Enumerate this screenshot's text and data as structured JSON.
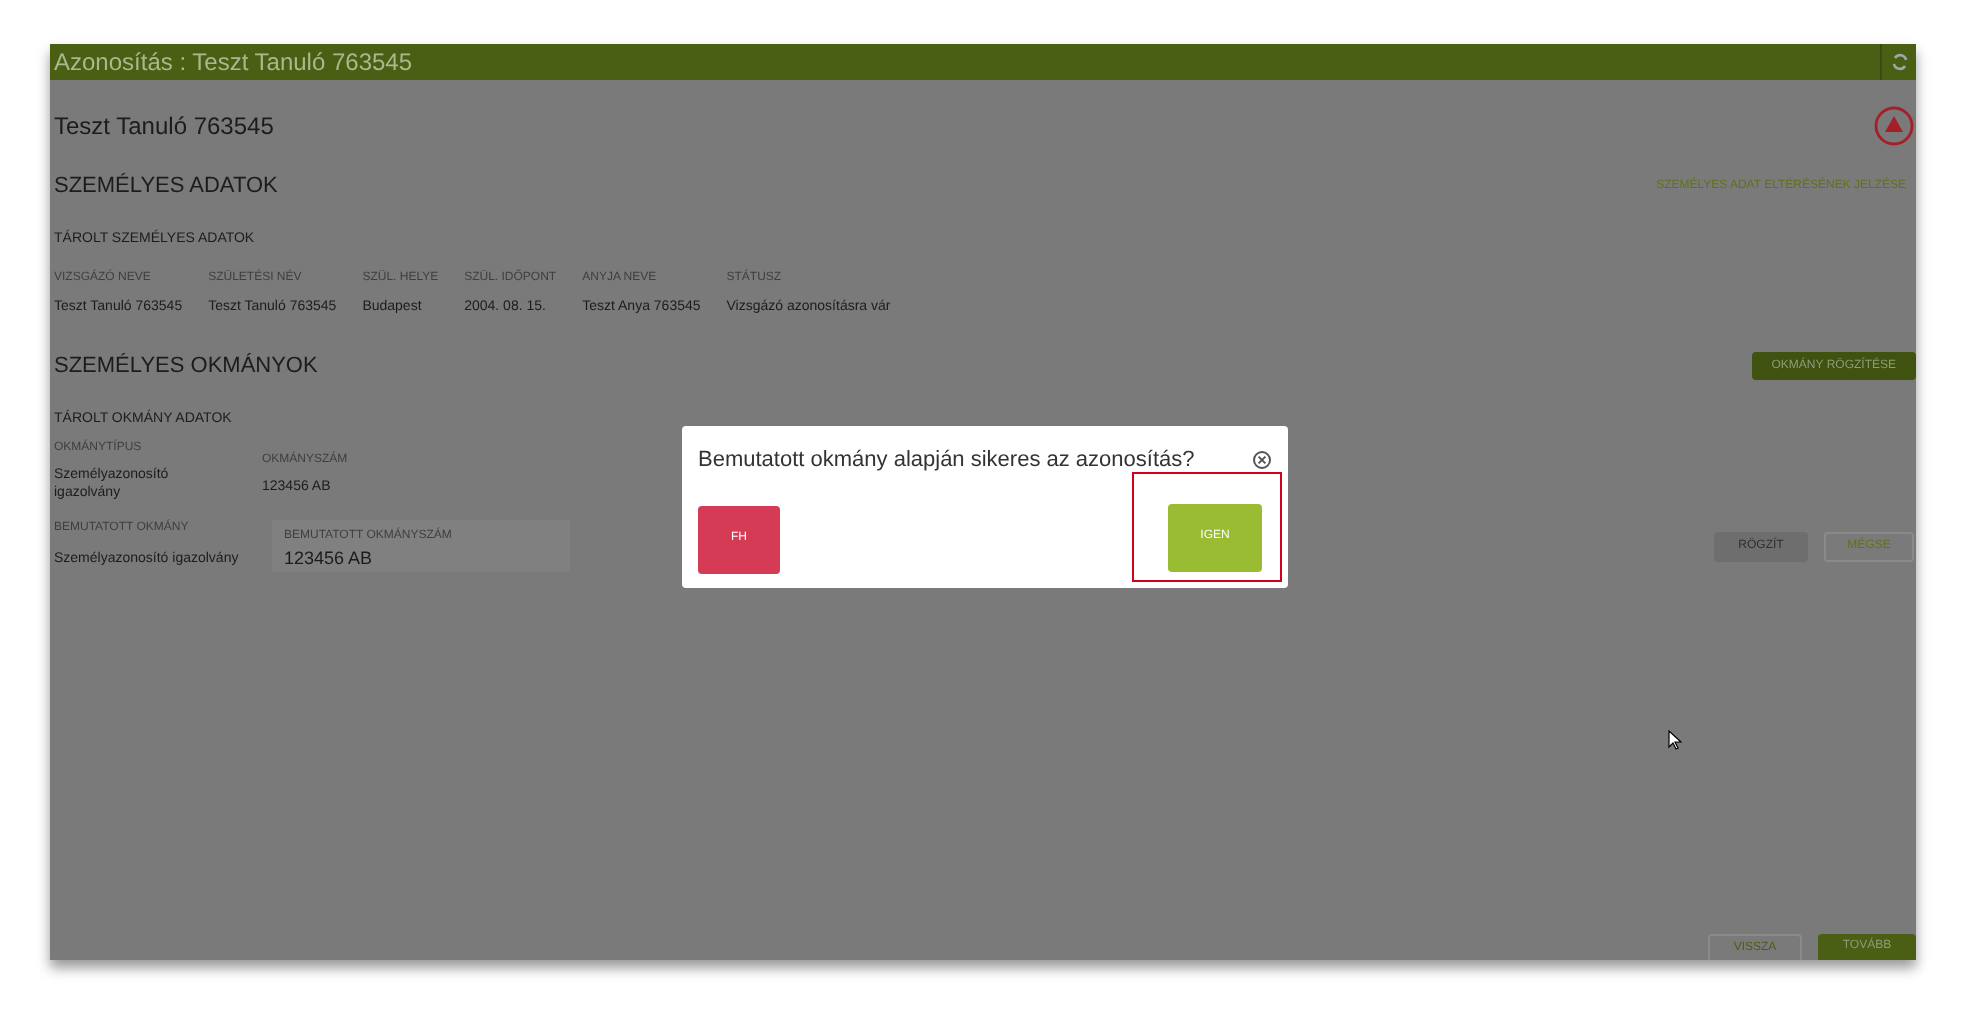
{
  "window": {
    "title": "Azonosítás : Teszt Tanuló 763545"
  },
  "student_name": "Teszt Tanuló 763545",
  "personal_data": {
    "heading": "SZEMÉLYES ADATOK",
    "report_link": "SZEMÉLYES ADAT ELTÉRÉSÉNEK JELZÉSE",
    "subheading": "TÁROLT SZEMÉLYES ADATOK",
    "fields": [
      {
        "label": "VIZSGÁZÓ NEVE",
        "value": "Teszt Tanuló 763545"
      },
      {
        "label": "SZÜLETÉSI NÉV",
        "value": "Teszt Tanuló 763545"
      },
      {
        "label": "SZÜL. HELYE",
        "value": "Budapest"
      },
      {
        "label": "SZÜL. IDŐPONT",
        "value": "2004. 08. 15."
      },
      {
        "label": "ANYJA NEVE",
        "value": "Teszt Anya 763545"
      },
      {
        "label": "STÁTUSZ",
        "value": "Vizsgázó azonosításra vár"
      }
    ]
  },
  "documents": {
    "heading": "SZEMÉLYES OKMÁNYOK",
    "add_button": "OKMÁNY RÖGZÍTÉSE",
    "subheading": "TÁROLT OKMÁNY ADATOK",
    "stored": [
      {
        "label": "OKMÁNYTÍPUS",
        "value": "Személyazonosító igazolvány"
      },
      {
        "label": "OKMÁNYSZÁM",
        "value": "123456 AB"
      }
    ],
    "presented": {
      "label": "BEMUTATOTT OKMÁNY",
      "value": "Személyazonosító igazolvány",
      "number_field": {
        "label": "BEMUTATOTT OKMÁNYSZÁM",
        "value": "123456 AB"
      }
    },
    "buttons": [
      {
        "label": "RÖGZÍT",
        "disabled": true
      },
      {
        "label": "MÉGSE",
        "disabled": false
      }
    ]
  },
  "footer_buttons": [
    {
      "label": "VISSZA",
      "kind": "outline"
    },
    {
      "label": "TOVÁBB",
      "kind": "filled"
    }
  ],
  "dialog": {
    "question": "Bemutatott okmány alapján sikeres az azonosítás?",
    "no_button": "FH",
    "yes_button": "IGEN",
    "yes_highlighted": true
  }
}
